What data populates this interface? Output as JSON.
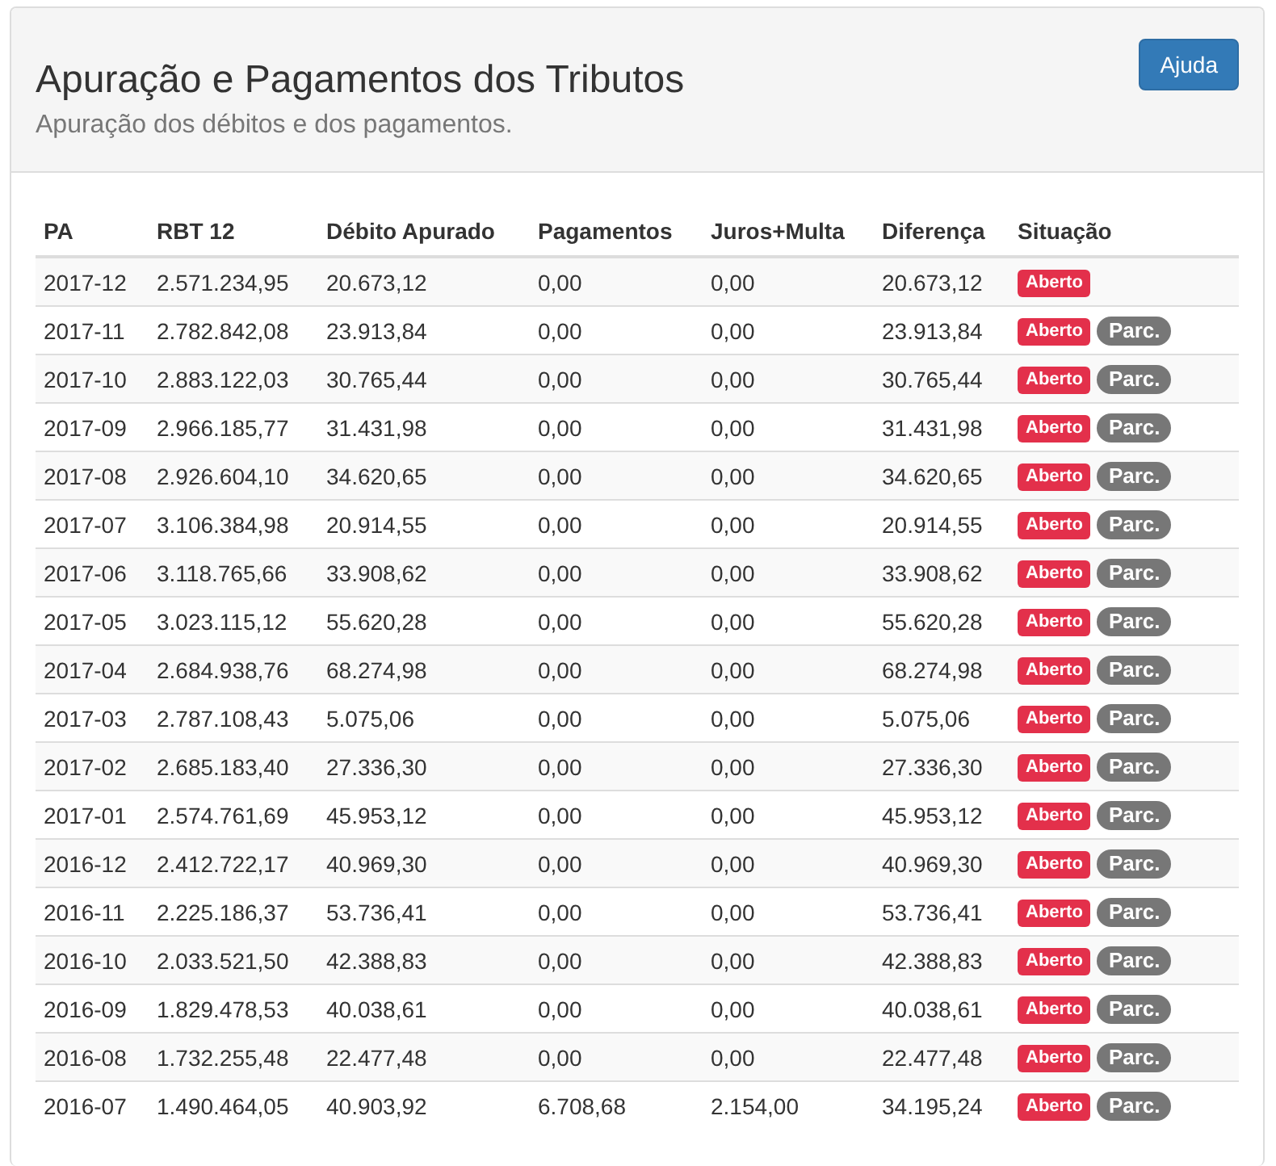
{
  "header": {
    "title": "Apuração e Pagamentos dos Tributos",
    "subtitle": "Apuração dos débitos e dos pagamentos.",
    "help_button": "Ajuda"
  },
  "table": {
    "columns": [
      "PA",
      "RBT 12",
      "Débito Apurado",
      "Pagamentos",
      "Juros+Multa",
      "Diferença",
      "Situação"
    ],
    "rows": [
      {
        "cells": [
          "2017-12",
          "2.571.234,95",
          "20.673,12",
          "0,00",
          "0,00",
          "20.673,12"
        ],
        "badges": [
          {
            "kind": "status",
            "label": "Aberto"
          }
        ]
      },
      {
        "cells": [
          "2017-11",
          "2.782.842,08",
          "23.913,84",
          "0,00",
          "0,00",
          "23.913,84"
        ],
        "badges": [
          {
            "kind": "status",
            "label": "Aberto"
          },
          {
            "kind": "pill",
            "label": "Parc."
          }
        ]
      },
      {
        "cells": [
          "2017-10",
          "2.883.122,03",
          "30.765,44",
          "0,00",
          "0,00",
          "30.765,44"
        ],
        "badges": [
          {
            "kind": "status",
            "label": "Aberto"
          },
          {
            "kind": "pill",
            "label": "Parc."
          }
        ]
      },
      {
        "cells": [
          "2017-09",
          "2.966.185,77",
          "31.431,98",
          "0,00",
          "0,00",
          "31.431,98"
        ],
        "badges": [
          {
            "kind": "status",
            "label": "Aberto"
          },
          {
            "kind": "pill",
            "label": "Parc."
          }
        ]
      },
      {
        "cells": [
          "2017-08",
          "2.926.604,10",
          "34.620,65",
          "0,00",
          "0,00",
          "34.620,65"
        ],
        "badges": [
          {
            "kind": "status",
            "label": "Aberto"
          },
          {
            "kind": "pill",
            "label": "Parc."
          }
        ]
      },
      {
        "cells": [
          "2017-07",
          "3.106.384,98",
          "20.914,55",
          "0,00",
          "0,00",
          "20.914,55"
        ],
        "badges": [
          {
            "kind": "status",
            "label": "Aberto"
          },
          {
            "kind": "pill",
            "label": "Parc."
          }
        ]
      },
      {
        "cells": [
          "2017-06",
          "3.118.765,66",
          "33.908,62",
          "0,00",
          "0,00",
          "33.908,62"
        ],
        "badges": [
          {
            "kind": "status",
            "label": "Aberto"
          },
          {
            "kind": "pill",
            "label": "Parc."
          }
        ]
      },
      {
        "cells": [
          "2017-05",
          "3.023.115,12",
          "55.620,28",
          "0,00",
          "0,00",
          "55.620,28"
        ],
        "badges": [
          {
            "kind": "status",
            "label": "Aberto"
          },
          {
            "kind": "pill",
            "label": "Parc."
          }
        ]
      },
      {
        "cells": [
          "2017-04",
          "2.684.938,76",
          "68.274,98",
          "0,00",
          "0,00",
          "68.274,98"
        ],
        "badges": [
          {
            "kind": "status",
            "label": "Aberto"
          },
          {
            "kind": "pill",
            "label": "Parc."
          }
        ]
      },
      {
        "cells": [
          "2017-03",
          "2.787.108,43",
          "5.075,06",
          "0,00",
          "0,00",
          "5.075,06"
        ],
        "badges": [
          {
            "kind": "status",
            "label": "Aberto"
          },
          {
            "kind": "pill",
            "label": "Parc."
          }
        ]
      },
      {
        "cells": [
          "2017-02",
          "2.685.183,40",
          "27.336,30",
          "0,00",
          "0,00",
          "27.336,30"
        ],
        "badges": [
          {
            "kind": "status",
            "label": "Aberto"
          },
          {
            "kind": "pill",
            "label": "Parc."
          }
        ]
      },
      {
        "cells": [
          "2017-01",
          "2.574.761,69",
          "45.953,12",
          "0,00",
          "0,00",
          "45.953,12"
        ],
        "badges": [
          {
            "kind": "status",
            "label": "Aberto"
          },
          {
            "kind": "pill",
            "label": "Parc."
          }
        ]
      },
      {
        "cells": [
          "2016-12",
          "2.412.722,17",
          "40.969,30",
          "0,00",
          "0,00",
          "40.969,30"
        ],
        "badges": [
          {
            "kind": "status",
            "label": "Aberto"
          },
          {
            "kind": "pill",
            "label": "Parc."
          }
        ]
      },
      {
        "cells": [
          "2016-11",
          "2.225.186,37",
          "53.736,41",
          "0,00",
          "0,00",
          "53.736,41"
        ],
        "badges": [
          {
            "kind": "status",
            "label": "Aberto"
          },
          {
            "kind": "pill",
            "label": "Parc."
          }
        ]
      },
      {
        "cells": [
          "2016-10",
          "2.033.521,50",
          "42.388,83",
          "0,00",
          "0,00",
          "42.388,83"
        ],
        "badges": [
          {
            "kind": "status",
            "label": "Aberto"
          },
          {
            "kind": "pill",
            "label": "Parc."
          }
        ]
      },
      {
        "cells": [
          "2016-09",
          "1.829.478,53",
          "40.038,61",
          "0,00",
          "0,00",
          "40.038,61"
        ],
        "badges": [
          {
            "kind": "status",
            "label": "Aberto"
          },
          {
            "kind": "pill",
            "label": "Parc."
          }
        ]
      },
      {
        "cells": [
          "2016-08",
          "1.732.255,48",
          "22.477,48",
          "0,00",
          "0,00",
          "22.477,48"
        ],
        "badges": [
          {
            "kind": "status",
            "label": "Aberto"
          },
          {
            "kind": "pill",
            "label": "Parc."
          }
        ]
      },
      {
        "cells": [
          "2016-07",
          "1.490.464,05",
          "40.903,92",
          "6.708,68",
          "2.154,00",
          "34.195,24"
        ],
        "badges": [
          {
            "kind": "status",
            "label": "Aberto"
          },
          {
            "kind": "pill",
            "label": "Parc."
          }
        ]
      }
    ]
  }
}
